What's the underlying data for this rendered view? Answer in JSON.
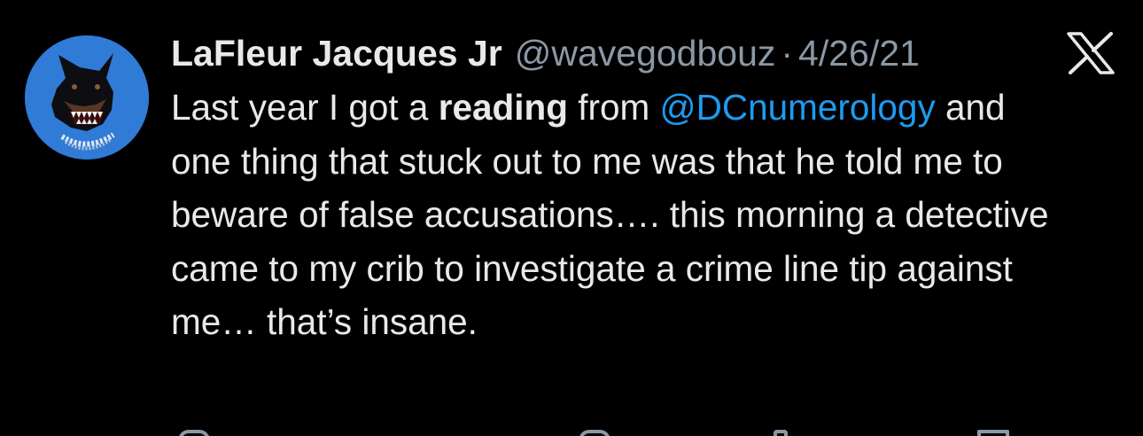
{
  "tweet": {
    "display_name": "LaFleur Jacques Jr",
    "handle": "@wavegodbouz",
    "separator": "·",
    "date": "4/26/21",
    "avatar_icon": "doberman-avatar-icon",
    "logo_icon": "x-logo-icon",
    "text": {
      "part1": "Last year I got a ",
      "bold": "reading",
      "part2": " from ",
      "mention": "@DCnumerology",
      "part3": " and one thing that stuck out to me was that he told me to beware of false accusations…. this morning a detective came to my crib to investigate a crime line tip against me… that’s insane."
    }
  },
  "colors": {
    "background": "#000000",
    "primary_text": "#e7e9ea",
    "secondary_text": "#8b98a5",
    "link": "#1d9bf0",
    "avatar_bg": "#2f7bd6"
  }
}
